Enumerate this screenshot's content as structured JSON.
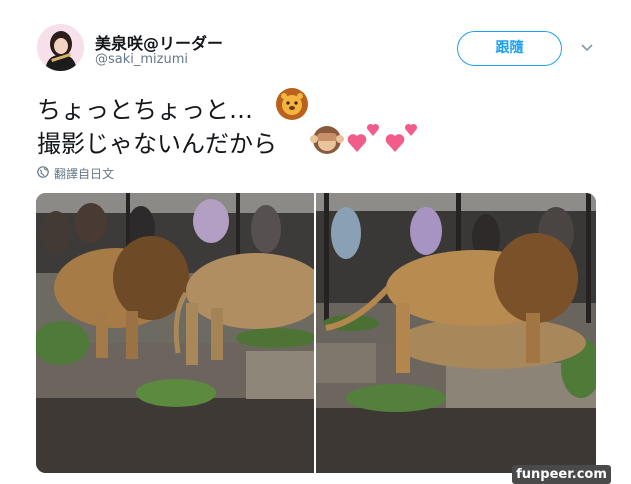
{
  "user": {
    "display_name": "美泉咲@リーダー",
    "handle": "@saki_mizumi"
  },
  "follow_button": {
    "label": "跟隨"
  },
  "tweet": {
    "line1": "ちょっとちょっと…",
    "line2": "撮影じゃないんだから"
  },
  "translate": {
    "label": "翻譯自日文"
  },
  "watermark": {
    "text": "funpeer.com"
  },
  "colors": {
    "accent": "#1da1f2",
    "secondary_text": "#657786",
    "primary_text": "#14171a"
  }
}
